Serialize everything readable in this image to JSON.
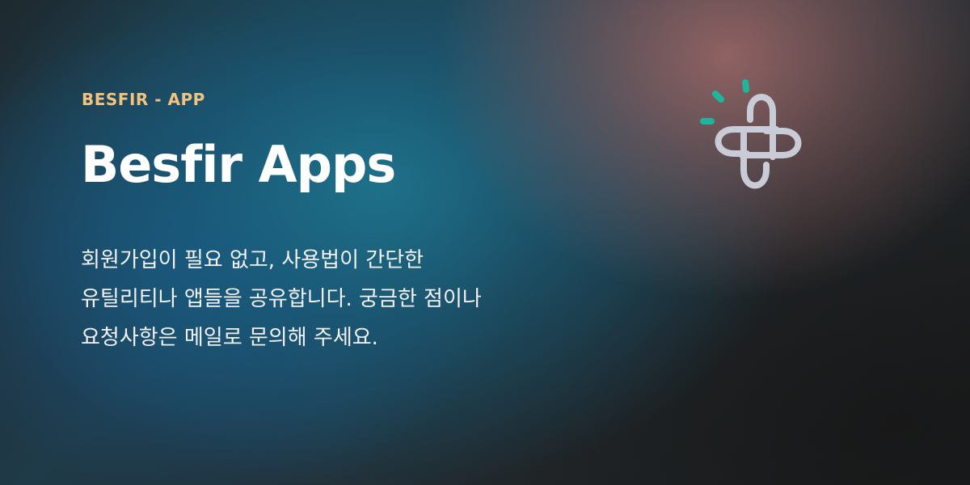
{
  "banner": {
    "eyebrow": "BESFIR - APP",
    "title": "Besfir Apps",
    "description": "회원가입이 필요 없고, 사용법이 간단한 유틸리티나 앱들을 공유합니다. 궁금한 점이나 요청사항은 메일로 문의해 주세요."
  },
  "logo": {
    "icon": "besfir-logo-icon",
    "accent_color": "#1fb59b",
    "mark_color": "#c9ccd6"
  },
  "colors": {
    "eyebrow": "#f3c37c",
    "title": "#ffffff",
    "description": "#f2f2f2"
  }
}
